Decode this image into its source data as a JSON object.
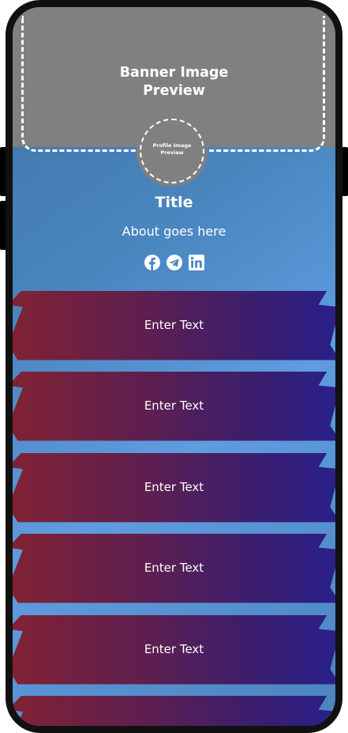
{
  "banner": {
    "line1": "Banner Image",
    "line2": "Preview"
  },
  "profile": {
    "line1": "Profile Image",
    "line2": "Preview"
  },
  "title": "Title",
  "about": "About goes here",
  "socials": [
    {
      "icon": "facebook-icon"
    },
    {
      "icon": "telegram-icon"
    },
    {
      "icon": "linkedin-icon"
    }
  ],
  "links": [
    {
      "label": "Enter Text"
    },
    {
      "label": "Enter Text"
    },
    {
      "label": "Enter Text"
    },
    {
      "label": "Enter Text"
    },
    {
      "label": "Enter Text"
    },
    {
      "label": ""
    }
  ],
  "colors": {
    "banner": "#808080",
    "background": "#4a86bf",
    "link_gradient_start": "#822233",
    "link_gradient_end": "#28208a"
  }
}
